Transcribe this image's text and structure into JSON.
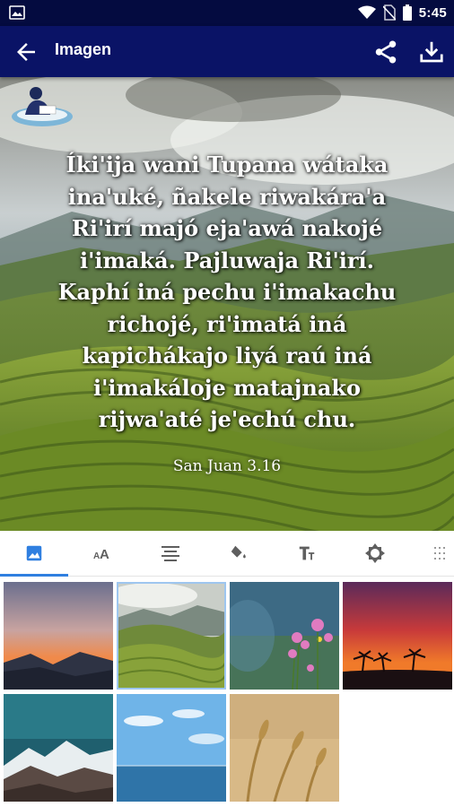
{
  "status_bar": {
    "time": "5:45"
  },
  "app_bar": {
    "title": "Imagen"
  },
  "verse": {
    "text": "Íki'ija wani Tupana wátaka\nina'uké, ñakele riwakára'a\nRi'irí majó eja'awá nakojé\ni'imaká. Pajluwaja Ri'irí.\nKaphí iná pechu i'imakachu\nrichojé, ri'imatá iná\nkapichákajo liyá raú iná\ni'imakáloje matajnako\nrijwa'até je'echú chu.",
    "reference": "San Juan 3.16"
  },
  "tabs": [
    {
      "icon": "image-icon",
      "active": true
    },
    {
      "icon": "text-size-icon",
      "active": false
    },
    {
      "icon": "align-center-icon",
      "active": false
    },
    {
      "icon": "paint-bucket-icon",
      "active": false
    },
    {
      "icon": "font-icon",
      "active": false
    },
    {
      "icon": "brightness-icon",
      "active": false
    },
    {
      "icon": "texture-icon",
      "active": false
    }
  ],
  "backgrounds": [
    {
      "name": "sunset-mountains",
      "selected": false
    },
    {
      "name": "green-hills",
      "selected": true
    },
    {
      "name": "pink-flowers",
      "selected": false
    },
    {
      "name": "palm-sunset",
      "selected": false
    },
    {
      "name": "snowy-mountain",
      "selected": false
    },
    {
      "name": "sea-sky",
      "selected": false
    },
    {
      "name": "wheat-field",
      "selected": false
    }
  ],
  "colors": {
    "status_bar": "#040b40",
    "app_bar": "#0a1366",
    "tab_accent": "#2f7fe0",
    "active_icon": "#2f7fe0",
    "inactive_icon": "#5f5f5f"
  }
}
